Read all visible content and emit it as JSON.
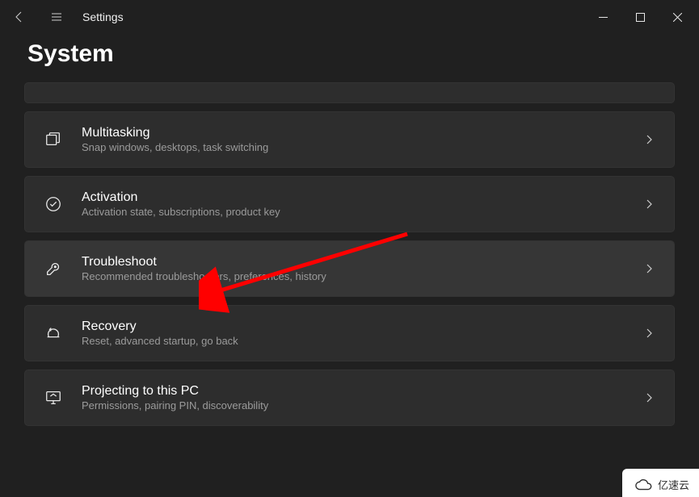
{
  "app": {
    "title": "Settings"
  },
  "page": {
    "title": "System"
  },
  "items": [
    {
      "id": "multitasking",
      "title": "Multitasking",
      "desc": "Snap windows, desktops, task switching"
    },
    {
      "id": "activation",
      "title": "Activation",
      "desc": "Activation state, subscriptions, product key"
    },
    {
      "id": "troubleshoot",
      "title": "Troubleshoot",
      "desc": "Recommended troubleshooters, preferences, history"
    },
    {
      "id": "recovery",
      "title": "Recovery",
      "desc": "Reset, advanced startup, go back"
    },
    {
      "id": "projecting",
      "title": "Projecting to this PC",
      "desc": "Permissions, pairing PIN, discoverability"
    }
  ],
  "watermark": {
    "text": "亿速云"
  },
  "annotation": {
    "arrow_color": "#ff0000"
  }
}
